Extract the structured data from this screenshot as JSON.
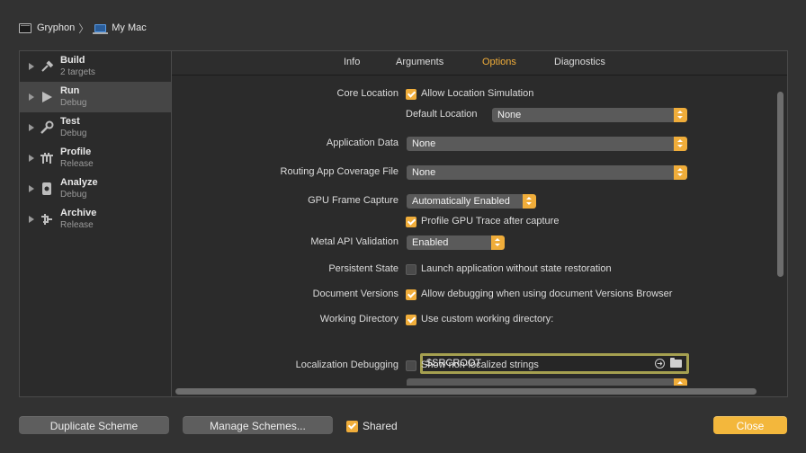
{
  "breadcrumb": {
    "project": "Gryphon",
    "destination": "My Mac"
  },
  "sidebar": {
    "items": [
      {
        "title": "Build",
        "subtitle": "2 targets",
        "icon": "hammer-icon"
      },
      {
        "title": "Run",
        "subtitle": "Debug",
        "icon": "play-icon",
        "selected": true
      },
      {
        "title": "Test",
        "subtitle": "Debug",
        "icon": "wrench-icon"
      },
      {
        "title": "Profile",
        "subtitle": "Release",
        "icon": "instruments-icon"
      },
      {
        "title": "Analyze",
        "subtitle": "Debug",
        "icon": "analyze-icon"
      },
      {
        "title": "Archive",
        "subtitle": "Release",
        "icon": "archive-icon"
      }
    ]
  },
  "tabs": [
    {
      "label": "Info"
    },
    {
      "label": "Arguments"
    },
    {
      "label": "Options",
      "active": true
    },
    {
      "label": "Diagnostics"
    }
  ],
  "options": {
    "core_location": {
      "label": "Core Location",
      "checkbox": "Allow Location Simulation",
      "checked": true,
      "default_location_label": "Default Location",
      "default_location_value": "None"
    },
    "application_data": {
      "label": "Application Data",
      "value": "None"
    },
    "routing_file": {
      "label": "Routing App Coverage File",
      "value": "None"
    },
    "gpu_frame_capture": {
      "label": "GPU Frame Capture",
      "value": "Automatically Enabled",
      "sub_checkbox": "Profile GPU Trace after capture",
      "sub_checked": true
    },
    "metal_api": {
      "label": "Metal API Validation",
      "value": "Enabled"
    },
    "persistent_state": {
      "label": "Persistent State",
      "checkbox": "Launch application without state restoration",
      "checked": false
    },
    "document_versions": {
      "label": "Document Versions",
      "checkbox": "Allow debugging when using document Versions Browser",
      "checked": true
    },
    "working_directory": {
      "label": "Working Directory",
      "checkbox": "Use custom working directory:",
      "checked": true,
      "value": "$SRCROOT"
    },
    "localization_debugging": {
      "label": "Localization Debugging",
      "checkbox": "Show non-localized strings",
      "checked": false
    }
  },
  "footer": {
    "duplicate_label": "Duplicate Scheme",
    "manage_label": "Manage Schemes...",
    "shared_label": "Shared",
    "shared_checked": true,
    "close_label": "Close"
  },
  "colors": {
    "accent": "#f0ad3a",
    "background": "#323232",
    "panel": "#2b2b2b",
    "popup": "#5a5a5a"
  }
}
